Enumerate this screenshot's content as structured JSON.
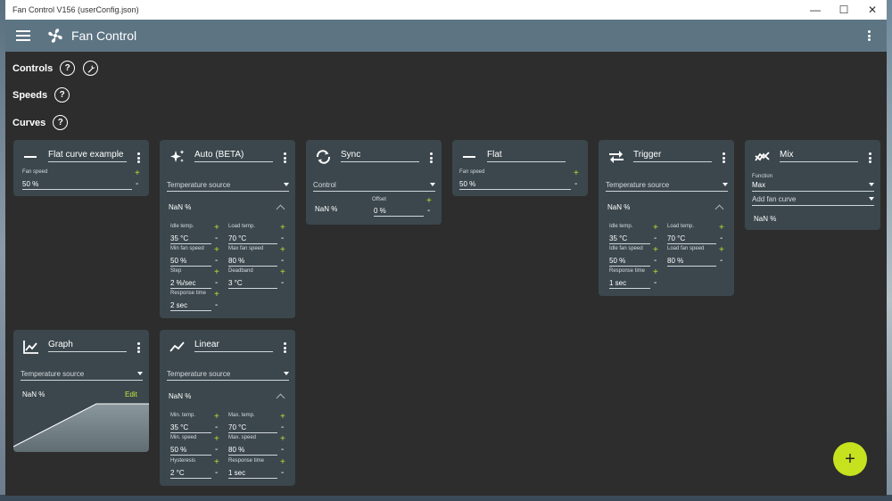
{
  "window": {
    "title": "Fan Control V156 (userConfig.json)"
  },
  "appbar": {
    "title": "Fan Control"
  },
  "sections": {
    "controls": "Controls",
    "speeds": "Speeds",
    "curves": "Curves"
  },
  "labels": {
    "help": "?",
    "edit": "Edit",
    "fab": "+",
    "plus": "+",
    "minus": "-"
  },
  "cards": {
    "flat_example": {
      "name": "Flat curve example",
      "fan_speed_label": "Fan speed",
      "fan_speed": "50 %"
    },
    "auto": {
      "name": "Auto (BETA)",
      "source": "Temperature source",
      "nan": "NaN %",
      "idle_temp_label": "Idle temp.",
      "idle_temp": "35 °C",
      "load_temp_label": "Load temp.",
      "load_temp": "70 °C",
      "min_speed_label": "Min fan speed",
      "min_speed": "50 %",
      "max_speed_label": "Max fan speed",
      "max_speed": "80 %",
      "step_label": "Step",
      "step": "2 %/sec",
      "deadband_label": "Deadband",
      "deadband": "3 °C",
      "response_label": "Response time",
      "response": "2 sec"
    },
    "sync": {
      "name": "Sync",
      "control": "Control",
      "nan": "NaN %",
      "offset_label": "Offset",
      "offset": "0 %"
    },
    "flat": {
      "name": "Flat",
      "fan_speed_label": "Fan speed",
      "fan_speed": "50 %"
    },
    "trigger": {
      "name": "Trigger",
      "source": "Temperature source",
      "nan": "NaN %",
      "idle_temp_label": "Idle temp.",
      "idle_temp": "35 °C",
      "load_temp_label": "Load temp.",
      "load_temp": "70 °C",
      "idle_speed_label": "Idle fan speed",
      "idle_speed": "50 %",
      "load_speed_label": "Load fan speed",
      "load_speed": "80 %",
      "response_label": "Response time",
      "response": "1 sec"
    },
    "mix": {
      "name": "Mix",
      "function_label": "Function",
      "function": "Max",
      "add": "Add fan curve",
      "nan": "NaN %"
    },
    "graph": {
      "name": "Graph",
      "source": "Temperature source",
      "nan": "NaN %",
      "edit": "Edit"
    },
    "linear": {
      "name": "Linear",
      "source": "Temperature source",
      "nan": "NaN %",
      "min_temp_label": "Min. temp.",
      "min_temp": "35 °C",
      "max_temp_label": "Max. temp.",
      "max_temp": "70 °C",
      "min_speed_label": "Min. speed",
      "min_speed": "50 %",
      "max_speed_label": "Max. speed",
      "max_speed": "80 %",
      "hysteresis_label": "Hysteresis",
      "hysteresis": "2 °C",
      "response_label": "Response time",
      "response": "1 sec"
    }
  },
  "colors": {
    "appbar": "#5d7483",
    "card": "#3b474d",
    "background": "#2d2d2d",
    "accent": "#c6e21f"
  }
}
